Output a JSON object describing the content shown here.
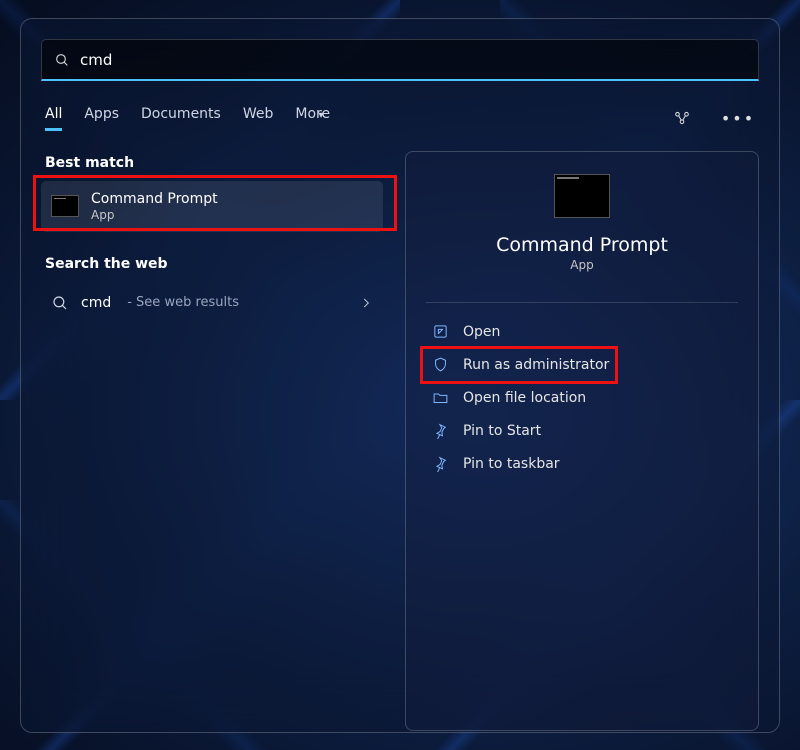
{
  "search": {
    "value": "cmd"
  },
  "tabs": {
    "all": "All",
    "apps": "Apps",
    "documents": "Documents",
    "web": "Web",
    "more": "More"
  },
  "left": {
    "best_match_label": "Best match",
    "result": {
      "title": "Command Prompt",
      "subtitle": "App"
    },
    "search_web_label": "Search the web",
    "web": {
      "term": "cmd",
      "hint": "- See web results"
    }
  },
  "detail": {
    "title": "Command Prompt",
    "subtitle": "App",
    "actions": {
      "open": "Open",
      "run_admin": "Run as administrator",
      "open_location": "Open file location",
      "pin_start": "Pin to Start",
      "pin_taskbar": "Pin to taskbar"
    }
  },
  "annotations": {
    "highlight_result": true,
    "highlight_run_admin": true
  }
}
